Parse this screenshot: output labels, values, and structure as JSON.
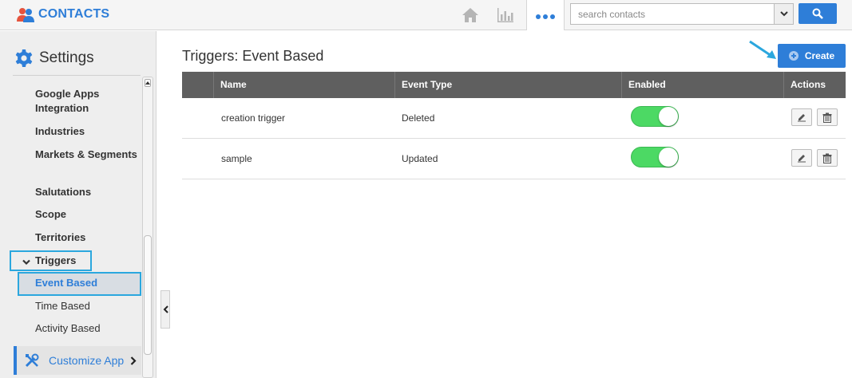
{
  "app": {
    "title": "CONTACTS",
    "search_placeholder": "search contacts"
  },
  "sidebar": {
    "title": "Settings",
    "items": [
      {
        "label": "Google Apps Integration"
      },
      {
        "label": "Industries"
      },
      {
        "label": "Markets & Segments"
      },
      {
        "label": "Salutations"
      },
      {
        "label": "Scope"
      },
      {
        "label": "Territories"
      },
      {
        "label": "Triggers"
      }
    ],
    "subitems": [
      {
        "label": "Event Based"
      },
      {
        "label": "Time Based"
      },
      {
        "label": "Activity Based"
      }
    ],
    "customize_label": "Customize App"
  },
  "main": {
    "title": "Triggers: Event Based",
    "create_label": "Create",
    "columns": [
      "Name",
      "Event Type",
      "Enabled",
      "Actions"
    ],
    "rows": [
      {
        "name": "creation trigger",
        "event_type": "Deleted",
        "enabled": true
      },
      {
        "name": "sample",
        "event_type": "Updated",
        "enabled": true
      }
    ]
  },
  "colors": {
    "accent": "#2e7ed8",
    "highlight": "#2ba7de",
    "toggle_on": "#4cd964",
    "header_bg": "#5f5f5f"
  }
}
